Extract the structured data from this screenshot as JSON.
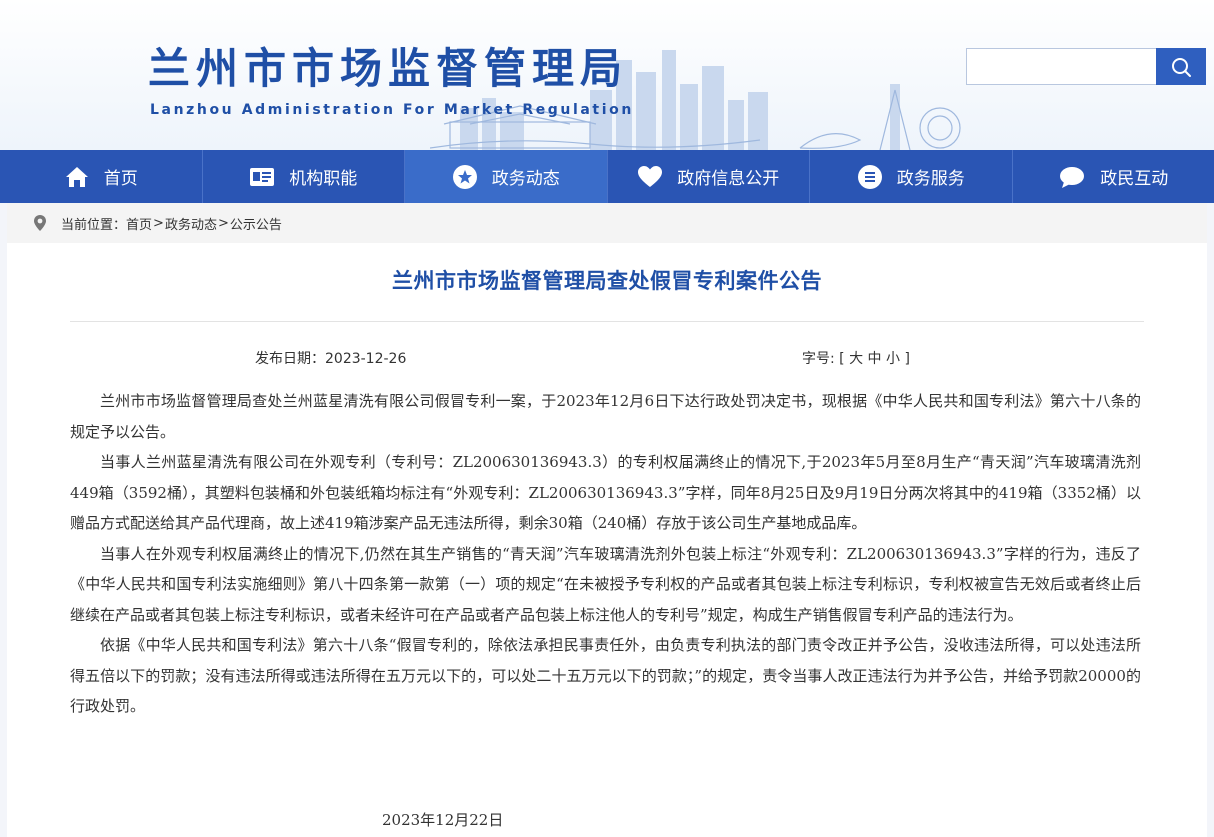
{
  "site": {
    "title": "兰州市市场监督管理局",
    "subtitle": "Lanzhou Administration For Market Regulation"
  },
  "search": {
    "placeholder": "",
    "icon": "search-icon"
  },
  "nav": [
    {
      "label": "首页",
      "icon": "home-icon"
    },
    {
      "label": "机构职能",
      "icon": "id-card-icon"
    },
    {
      "label": "政务动态",
      "icon": "star-icon",
      "active": true
    },
    {
      "label": "政府信息公开",
      "icon": "heart-icon"
    },
    {
      "label": "政务服务",
      "icon": "list-icon"
    },
    {
      "label": "政民互动",
      "icon": "chat-icon"
    }
  ],
  "breadcrumb": {
    "prefix": "当前位置：",
    "items": [
      "首页",
      "政务动态",
      "公示公告"
    ],
    "separator": ">"
  },
  "article": {
    "title": "兰州市市场监督管理局查处假冒专利案件公告",
    "date_label": "发布日期：2023-12-26",
    "font_label": "字号:",
    "font_open": "[",
    "font_sizes": [
      "大",
      "中",
      "小"
    ],
    "font_close": "]",
    "paragraphs": [
      "兰州市市场监督管理局查处兰州蓝星清洗有限公司假冒专利一案，于2023年12月6日下达行政处罚决定书，现根据《中华人民共和国专利法》第六十八条的规定予以公告。",
      "当事人兰州蓝星清洗有限公司在外观专利（专利号：ZL200630136943.3）的专利权届满终止的情况下,于2023年5月至8月生产“青天润”汽车玻璃清洗剂449箱（3592桶），其塑料包装桶和外包装纸箱均标注有“外观专利：ZL200630136943.3”字样，同年8月25日及9月19日分两次将其中的419箱（3352桶）以赠品方式配送给其产品代理商，故上述419箱涉案产品无违法所得，剩余30箱（240桶）存放于该公司生产基地成品库。",
      "当事人在外观专利权届满终止的情况下,仍然在其生产销售的“青天润”汽车玻璃清洗剂外包装上标注“外观专利：ZL200630136943.3”字样的行为，违反了《中华人民共和国专利法实施细则》第八十四条第一款第（一）项的规定“在未被授予专利权的产品或者其包装上标注专利标识，专利权被宣告无效后或者终止后继续在产品或者其包装上标注专利标识，或者未经许可在产品或者产品包装上标注他人的专利号”规定，构成生产销售假冒专利产品的违法行为。",
      "依据《中华人民共和国专利法》第六十八条“假冒专利的，除依法承担民事责任外，由负责专利执法的部门责令改正并予公告，没收违法所得，可以处违法所得五倍以下的罚款；没有违法所得或违法所得在五万元以下的，可以处二十五万元以下的罚款；”的规定，责令当事人改正违法行为并予公告，并给予罚款20000的行政处罚。"
    ],
    "sign_date": "2023年12月22日"
  },
  "colors": {
    "brand": "#1f4fa6",
    "nav_bg": "#2a55b4",
    "nav_active": "#3a6cc9"
  }
}
